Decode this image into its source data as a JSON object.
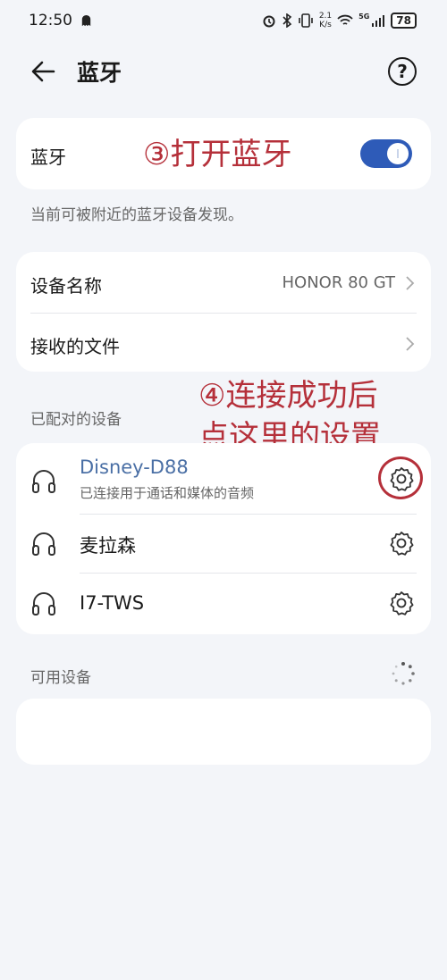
{
  "status_bar": {
    "time": "12:50",
    "speed_value": "2.1",
    "speed_unit": "K/s",
    "network": "5G",
    "battery": "78"
  },
  "header": {
    "title": "蓝牙",
    "help": "?"
  },
  "bluetooth": {
    "label": "蓝牙",
    "enabled": true,
    "annotation": "③打开蓝牙",
    "discoverable_text": "当前可被附近的蓝牙设备发现。"
  },
  "device_name": {
    "label": "设备名称",
    "value": "HONOR 80 GT"
  },
  "received_files": {
    "label": "接收的文件"
  },
  "paired": {
    "section_label": "已配对的设备",
    "annotation_line1": "④连接成功后",
    "annotation_line2": "点这里的设置",
    "devices": [
      {
        "name": "Disney-D88",
        "status": "已连接用于通话和媒体的音频",
        "connected": true
      },
      {
        "name": "麦拉森"
      },
      {
        "name": "I7-TWS"
      }
    ]
  },
  "available": {
    "section_label": "可用设备"
  },
  "colors": {
    "accent": "#2e5bb8",
    "annotation": "#b5303a",
    "connected_name": "#4a6fa5"
  }
}
